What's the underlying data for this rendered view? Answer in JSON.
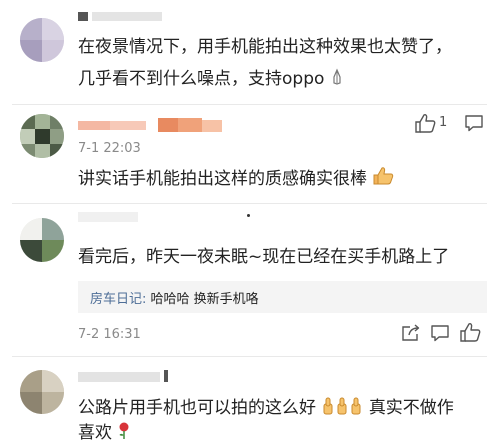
{
  "comments": [
    {
      "text_line1": "在夜景情况下，用手机能拍出这种效果也太赞了，",
      "text_line2": "几乎看不到什么噪点，支持oppo"
    },
    {
      "timestamp": "7-1 22:03",
      "like_count": "1",
      "text": "讲实话手机能拍出这样的质感确实很棒"
    },
    {
      "text": "看完后，昨天一夜未眠~现在已经在买手机路上了",
      "reply": {
        "author": "房车日记:",
        "content": " 哈哈哈 换新手机咯"
      },
      "timestamp": "7-2 16:31"
    },
    {
      "text_line1": "公路片用手机也可以拍的这么好",
      "text_line1_tail": " 真实不做作",
      "text_line2": "喜欢"
    }
  ],
  "colors": {
    "link_blue": "#4e6e97",
    "timestamp_gray": "#8a8a8a",
    "reply_bg": "#f4f4f4"
  },
  "icons": [
    "thumbs-up-icon",
    "comment-icon",
    "share-icon",
    "thumbs-up-emoji",
    "rose-emoji",
    "praying-hands-emoji"
  ]
}
